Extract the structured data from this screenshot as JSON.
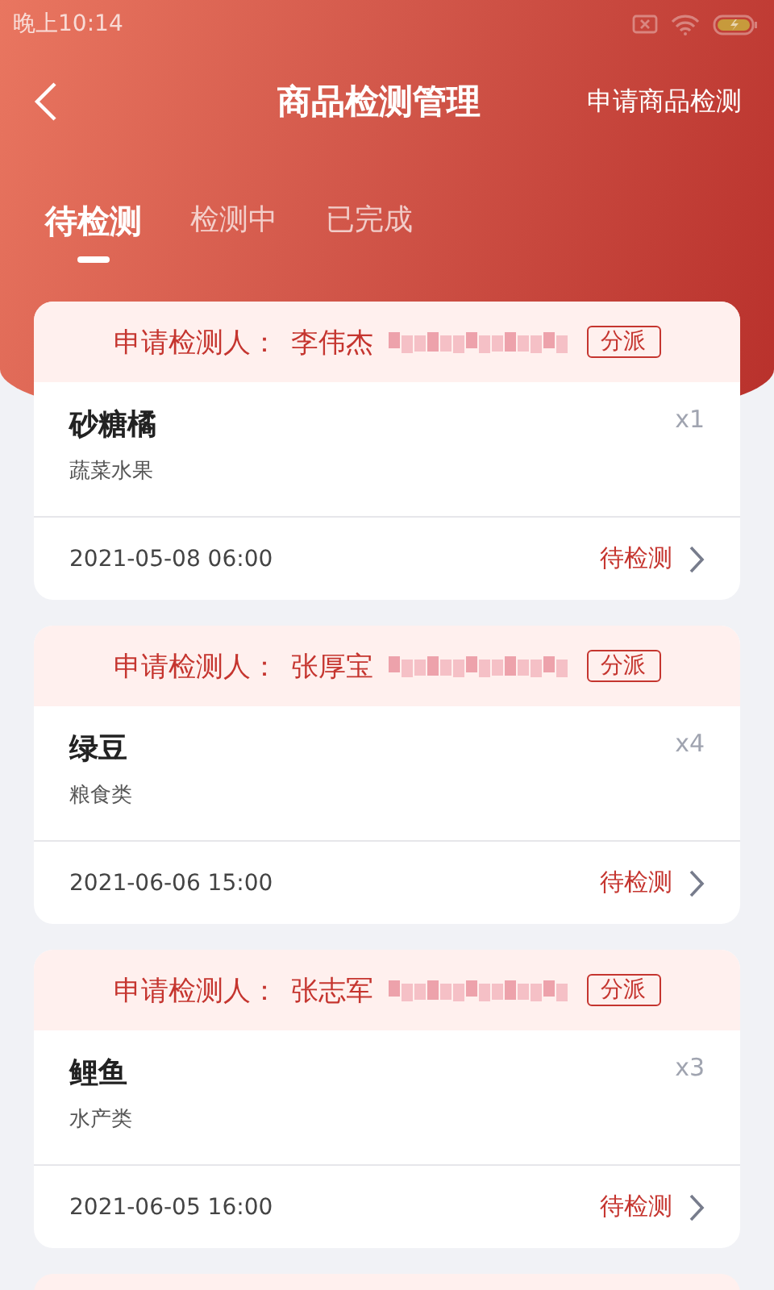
{
  "status_bar": {
    "time": "晚上10:14"
  },
  "nav": {
    "title": "商品检测管理",
    "action": "申请商品检测"
  },
  "tabs": [
    {
      "label": "待检测",
      "selected": true
    },
    {
      "label": "检测中",
      "selected": false
    },
    {
      "label": "已完成",
      "selected": false
    }
  ],
  "orders": [
    {
      "applicant_label": "申请检测人：",
      "applicant": "李伟杰",
      "assign": "分派",
      "product": "砂糖橘",
      "category": "蔬菜水果",
      "quantity": "x1",
      "time": "2021-05-08 06:00",
      "status": "待检测"
    },
    {
      "applicant_label": "申请检测人：",
      "applicant": "张厚宝",
      "assign": "分派",
      "product": "绿豆",
      "category": "粮食类",
      "quantity": "x4",
      "time": "2021-06-06 15:00",
      "status": "待检测"
    },
    {
      "applicant_label": "申请检测人：",
      "applicant": "张志军",
      "assign": "分派",
      "product": "鲤鱼",
      "category": "水产类",
      "quantity": "x3",
      "time": "2021-06-05 16:00",
      "status": "待检测"
    }
  ]
}
